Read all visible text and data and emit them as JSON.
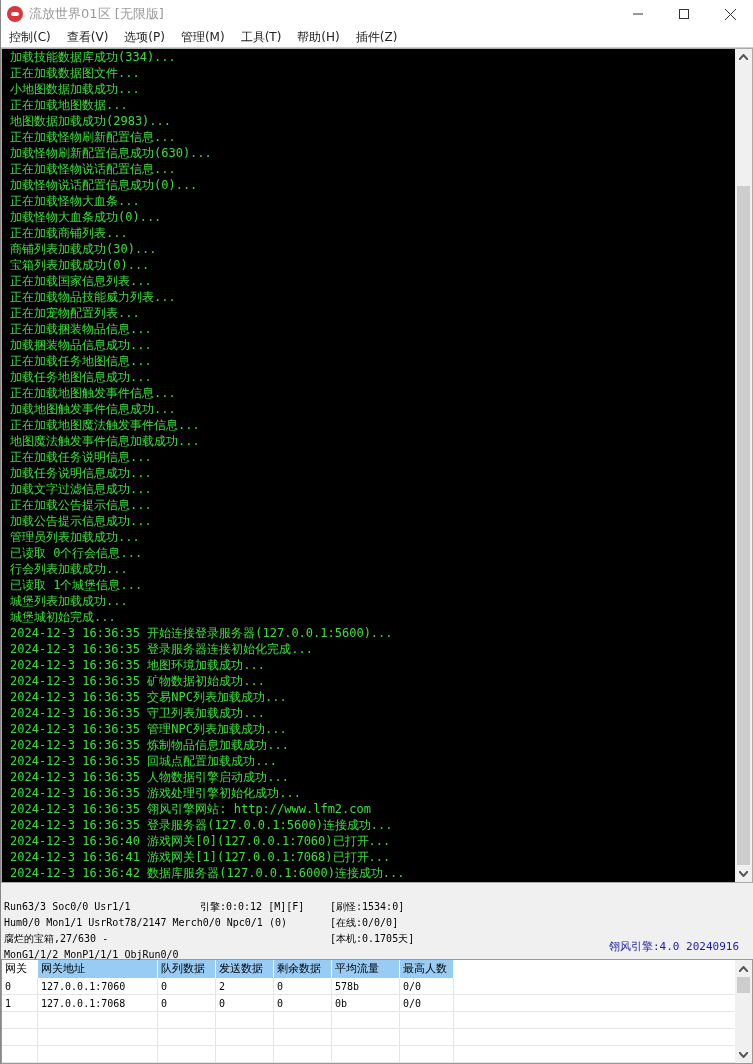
{
  "window": {
    "title": "流放世界01区 [无限版]"
  },
  "menu": [
    "控制(C)",
    "查看(V)",
    "选项(P)",
    "管理(M)",
    "工具(T)",
    "帮助(H)",
    "插件(Z)"
  ],
  "log": [
    "加载技能数据库成功(334)...",
    "正在加载数据图文件...",
    "小地图数据加载成功...",
    "正在加载地图数据...",
    "地图数据加载成功(2983)...",
    "正在加载怪物刷新配置信息...",
    "加载怪物刷新配置信息成功(630)...",
    "正在加载怪物说话配置信息...",
    "加载怪物说话配置信息成功(0)...",
    "正在加载怪物大血条...",
    "加载怪物大血条成功(0)...",
    "正在加载商铺列表...",
    "商铺列表加载成功(30)...",
    "宝箱列表加载成功(0)...",
    "正在加载国家信息列表...",
    "正在加载物品技能威力列表...",
    "正在加宠物配置列表...",
    "正在加载捆装物品信息...",
    "加载捆装物品信息成功...",
    "正在加载任务地图信息...",
    "加载任务地图信息成功...",
    "正在加载地图触发事件信息...",
    "加载地图触发事件信息成功...",
    "正在加载地图魔法触发事件信息...",
    "地图魔法触发事件信息加载成功...",
    "正在加载任务说明信息...",
    "加载任务说明信息成功...",
    "加载文字过滤信息成功...",
    "正在加载公告提示信息...",
    "加载公告提示信息成功...",
    "管理员列表加载成功...",
    "已读取 0个行会信息...",
    "行会列表加载成功...",
    "已读取 1个城堡信息...",
    "城堡列表加载成功...",
    "城堡城初始完成...",
    "2024-12-3 16:36:35 开始连接登录服务器(127.0.0.1:5600)...",
    "2024-12-3 16:36:35 登录服务器连接初始化完成...",
    "2024-12-3 16:36:35 地图环境加载成功...",
    "2024-12-3 16:36:35 矿物数据初始成功...",
    "2024-12-3 16:36:35 交易NPC列表加载成功...",
    "2024-12-3 16:36:35 守卫列表加载成功...",
    "2024-12-3 16:36:35 管理NPC列表加载成功...",
    "2024-12-3 16:36:35 炼制物品信息加载成功...",
    "2024-12-3 16:36:35 回城点配置加载成功...",
    "2024-12-3 16:36:35 人物数据引擎启动成功...",
    "2024-12-3 16:36:35 游戏处理引擎初始化成功...",
    "2024-12-3 16:36:35 翎风引擎网站: http://www.lfm2.com",
    "2024-12-3 16:36:35 登录服务器(127.0.0.1:5600)连接成功...",
    "2024-12-3 16:36:40 游戏网关[0](127.0.0.1:7060)已打开...",
    "2024-12-3 16:36:41 游戏网关[1](127.0.0.1:7068)已打开...",
    "2024-12-3 16:36:42 数据库服务器(127.0.0.1:6000)连接成功..."
  ],
  "status": {
    "rows": [
      [
        "Run63/3 Soc0/0 Usr1/1",
        "引擎:0:0:12 [M][F]",
        "[刷怪:1534:0]"
      ],
      [
        "Hum0/0 Mon1/1 UsrRot78/2147 Merch0/0 Npc0/1 (0)",
        "",
        "[在线:0/0/0]"
      ],
      [
        "腐烂的宝箱,27/630 -",
        "",
        "[本机:0.1705天]"
      ],
      [
        "MonG1/1/2 MonP1/1/1 ObjRun0/0",
        "",
        ""
      ]
    ],
    "version": "翎风引擎:4.0 20240916"
  },
  "table": {
    "columns": [
      {
        "label": "网关",
        "highlighted": false
      },
      {
        "label": "网关地址",
        "highlighted": true
      },
      {
        "label": "队列数据",
        "highlighted": true
      },
      {
        "label": "发送数据",
        "highlighted": true
      },
      {
        "label": "剩余数据",
        "highlighted": true
      },
      {
        "label": "平均流量",
        "highlighted": true
      },
      {
        "label": "最高人数",
        "highlighted": true
      }
    ],
    "rows": [
      [
        "0",
        "127.0.0.1:7060",
        "0",
        "2",
        "0",
        "578b",
        "0/0"
      ],
      [
        "1",
        "127.0.0.1:7068",
        "0",
        "0",
        "0",
        "0b",
        "0/0"
      ]
    ]
  }
}
